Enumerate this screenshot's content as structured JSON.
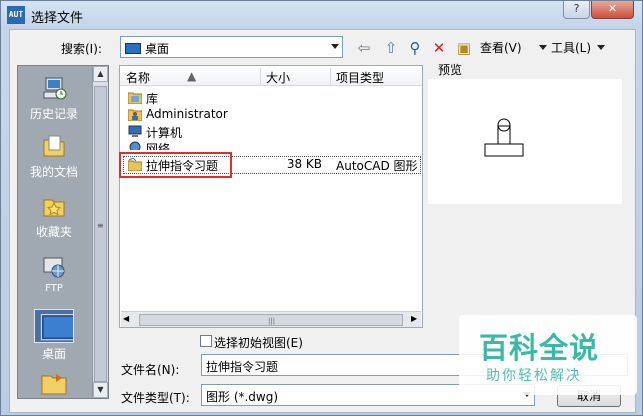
{
  "window": {
    "title": "选择文件",
    "app_icon_text": "AUT",
    "help_label": "?",
    "close_label": "✕"
  },
  "search": {
    "label": "搜索(I):",
    "location": "桌面"
  },
  "toolbar": {
    "view_label": "查看(V)",
    "tools_label": "工具(L)"
  },
  "places": [
    {
      "label": "历史记录",
      "icon": "history-icon"
    },
    {
      "label": "我的文档",
      "icon": "documents-icon"
    },
    {
      "label": "收藏夹",
      "icon": "favorites-icon"
    },
    {
      "label": "FTP",
      "icon": "ftp-icon"
    },
    {
      "label": "桌面",
      "icon": "desktop-icon",
      "selected": true
    }
  ],
  "file_list": {
    "columns": [
      "名称",
      "大小",
      "项目类型"
    ],
    "rows": [
      {
        "name": "库",
        "size": "",
        "type": "",
        "icon": "library-icon"
      },
      {
        "name": "Administrator",
        "size": "",
        "type": "",
        "icon": "user-folder-icon"
      },
      {
        "name": "计算机",
        "size": "",
        "type": "",
        "icon": "computer-icon"
      },
      {
        "name": "网络",
        "size": "",
        "type": "",
        "icon": "network-icon"
      },
      {
        "name": "拉伸指令习题",
        "size": "38 KB",
        "type": "AutoCAD 图形",
        "icon": "dwg-file-icon",
        "highlighted": true
      }
    ]
  },
  "preview": {
    "label": "预览"
  },
  "options": {
    "initial_view_label": "选择初始视图(E)"
  },
  "filename": {
    "label": "文件名(N):",
    "value": "拉伸指令习题"
  },
  "filetype": {
    "label": "文件类型(T):",
    "value": "图形 (*.dwg)"
  },
  "buttons": {
    "open": "取消"
  },
  "watermark": {
    "title": "百科全说",
    "subtitle": "助你轻松解决"
  },
  "colors": {
    "highlight_box": "#d9312d",
    "watermark": "#3bb9a6"
  }
}
